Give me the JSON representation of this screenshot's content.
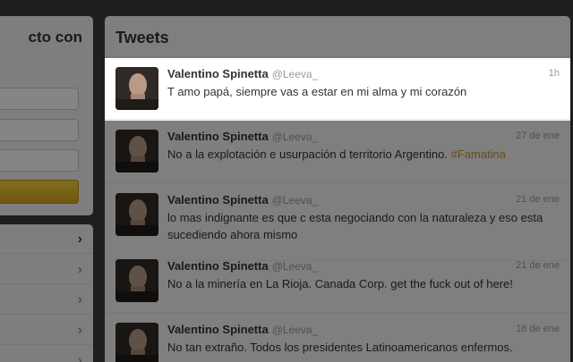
{
  "login": {
    "title": "cto con"
  },
  "tweets_panel": {
    "title": "Tweets",
    "tweets": [
      {
        "name": "Valentino Spinetta",
        "handle": "@Leeva_",
        "time": "1h",
        "text": "T amo papá, siempre vas a estar en mi alma y mi corazón",
        "hashtag": ""
      },
      {
        "name": "Valentino Spinetta",
        "handle": "@Leeva_",
        "time": "27 de ene",
        "text": "No a la explotación e usurpación d territorio Argentino. ",
        "hashtag": "#Famatina"
      },
      {
        "name": "Valentino Spinetta",
        "handle": "@Leeva_",
        "time": "21 de ene",
        "text": "lo mas indignante es que c esta negociando con la naturaleza y eso esta sucediendo ahora mismo",
        "hashtag": ""
      },
      {
        "name": "Valentino Spinetta",
        "handle": "@Leeva_",
        "time": "21 de ene",
        "text": "No a la minería en La Rioja. Canada Corp. get the fuck out of here!",
        "hashtag": ""
      },
      {
        "name": "Valentino Spinetta",
        "handle": "@Leeva_",
        "time": "18 de ene",
        "text": "No tan extraño. Todos los presidentes Latinoamericanos enfermos.",
        "hashtag": ""
      }
    ]
  },
  "icons": {
    "menu_chevron": "chevron-right-icon",
    "avatar": "user-avatar"
  }
}
